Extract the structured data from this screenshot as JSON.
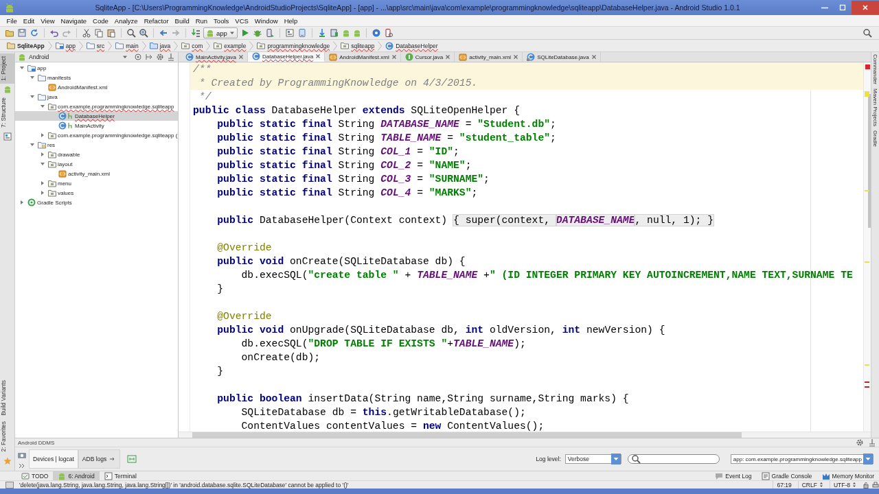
{
  "window": {
    "title": "SqliteApp - [C:\\Users\\ProgrammingKnowledge\\AndroidStudioProjects\\SqliteApp] - [app] - ...\\app\\src\\main\\java\\com\\example\\programmingknowledge\\sqliteapp\\DatabaseHelper.java - Android Studio 1.0.1"
  },
  "menu": [
    "File",
    "Edit",
    "View",
    "Navigate",
    "Code",
    "Analyze",
    "Refactor",
    "Build",
    "Run",
    "Tools",
    "VCS",
    "Window",
    "Help"
  ],
  "toolbar": {
    "run_config": "app"
  },
  "breadcrumbs": [
    {
      "label": "SqliteApp",
      "kind": "project",
      "error": false
    },
    {
      "label": "app",
      "kind": "module",
      "error": true
    },
    {
      "label": "src",
      "kind": "folder",
      "error": true
    },
    {
      "label": "main",
      "kind": "folder",
      "error": true
    },
    {
      "label": "java",
      "kind": "source",
      "error": true
    },
    {
      "label": "com",
      "kind": "package",
      "error": true
    },
    {
      "label": "example",
      "kind": "package",
      "error": true
    },
    {
      "label": "programmingknowledge",
      "kind": "package",
      "error": true
    },
    {
      "label": "sqliteapp",
      "kind": "package",
      "error": true
    },
    {
      "label": "DatabaseHelper",
      "kind": "class",
      "error": true
    }
  ],
  "side_tabs": {
    "left_top": [
      {
        "label": "1: Project",
        "selected": true
      },
      {
        "label": "7: Structure",
        "selected": false
      }
    ],
    "left_bottom": [
      {
        "label": "Build Variants",
        "selected": false
      },
      {
        "label": "2: Favorites",
        "selected": false
      }
    ],
    "right": [
      {
        "label": "Commander"
      },
      {
        "label": "Maven Projects"
      },
      {
        "label": "Gradle"
      }
    ]
  },
  "project": {
    "view": "Android",
    "tree": [
      {
        "label": "app",
        "kind": "module",
        "expanded": true,
        "selected": false,
        "error": false,
        "children": [
          {
            "label": "manifests",
            "kind": "folder",
            "expanded": true,
            "selected": false,
            "error": false,
            "children": [
              {
                "label": "AndroidManifest.xml",
                "kind": "xml",
                "selected": false,
                "error": false
              }
            ]
          },
          {
            "label": "java",
            "kind": "folder",
            "expanded": true,
            "selected": false,
            "error": false,
            "children": [
              {
                "label": "com.example.programmingknowledge.sqliteapp",
                "kind": "package",
                "expanded": true,
                "selected": false,
                "error": true,
                "children": [
                  {
                    "label": "DatabaseHelper",
                    "kind": "class",
                    "selected": true,
                    "error": true
                  },
                  {
                    "label": "MainActivity",
                    "kind": "class",
                    "selected": false,
                    "error": false
                  }
                ]
              },
              {
                "label": "com.example.programmingknowledge.sqliteapp (",
                "kind": "package",
                "expanded": false,
                "selected": false,
                "error": false
              }
            ]
          },
          {
            "label": "res",
            "kind": "resfolder",
            "expanded": true,
            "selected": false,
            "error": false,
            "children": [
              {
                "label": "drawable",
                "kind": "package",
                "expanded": false,
                "selected": false,
                "error": false
              },
              {
                "label": "layout",
                "kind": "package",
                "expanded": true,
                "selected": false,
                "error": false,
                "children": [
                  {
                    "label": "activity_main.xml",
                    "kind": "xml",
                    "selected": false,
                    "error": false
                  }
                ]
              },
              {
                "label": "menu",
                "kind": "package",
                "expanded": false,
                "selected": false,
                "error": false
              },
              {
                "label": "values",
                "kind": "package",
                "expanded": false,
                "selected": false,
                "error": false
              }
            ]
          }
        ]
      },
      {
        "label": "Gradle Scripts",
        "kind": "gradle",
        "expanded": false,
        "selected": false,
        "error": false
      }
    ]
  },
  "editor": {
    "tabs": [
      {
        "label": "MainActivity.java",
        "kind": "class",
        "selected": false,
        "error": true
      },
      {
        "label": "DatabaseHelper.java",
        "kind": "class",
        "selected": true,
        "error": true
      },
      {
        "label": "AndroidManifest.xml",
        "kind": "xml",
        "selected": false,
        "error": false
      },
      {
        "label": "Cursor.java",
        "kind": "interface",
        "selected": false,
        "error": false
      },
      {
        "label": "activity_main.xml",
        "kind": "xml",
        "selected": false,
        "error": false
      },
      {
        "label": "SQLiteDatabase.java",
        "kind": "library",
        "selected": false,
        "error": false
      }
    ],
    "lines": [
      {
        "highlighted": true,
        "segments": [
          {
            "kind": "comment",
            "text": "/**"
          }
        ]
      },
      {
        "highlighted": true,
        "segments": [
          {
            "kind": "comment",
            "text": " * Created by ProgrammingKnowledge on 4/3/2015."
          }
        ]
      },
      {
        "highlighted": false,
        "segments": [
          {
            "kind": "comment",
            "text": " */"
          }
        ]
      },
      {
        "highlighted": false,
        "segments": [
          {
            "kind": "keyword",
            "text": "public class"
          },
          {
            "kind": "plain",
            "text": " DatabaseHelper "
          },
          {
            "kind": "keyword",
            "text": "extends"
          },
          {
            "kind": "plain",
            "text": " SQLiteOpenHelper {"
          }
        ]
      },
      {
        "highlighted": false,
        "segments": [
          {
            "kind": "keyword",
            "text": "    public static final"
          },
          {
            "kind": "plain",
            "text": " String "
          },
          {
            "kind": "constant",
            "text": "DATABASE_NAME"
          },
          {
            "kind": "plain",
            "text": " = "
          },
          {
            "kind": "string",
            "text": "\"Student.db\""
          },
          {
            "kind": "plain",
            "text": ";"
          }
        ]
      },
      {
        "highlighted": false,
        "segments": [
          {
            "kind": "keyword",
            "text": "    public static final"
          },
          {
            "kind": "plain",
            "text": " String "
          },
          {
            "kind": "constant",
            "text": "TABLE_NAME"
          },
          {
            "kind": "plain",
            "text": " = "
          },
          {
            "kind": "string",
            "text": "\"student_table\""
          },
          {
            "kind": "plain",
            "text": ";"
          }
        ]
      },
      {
        "highlighted": false,
        "segments": [
          {
            "kind": "keyword",
            "text": "    public static final"
          },
          {
            "kind": "plain",
            "text": " String "
          },
          {
            "kind": "constant",
            "text": "COL_1"
          },
          {
            "kind": "plain",
            "text": " = "
          },
          {
            "kind": "string",
            "text": "\"ID\""
          },
          {
            "kind": "plain",
            "text": ";"
          }
        ]
      },
      {
        "highlighted": false,
        "segments": [
          {
            "kind": "keyword",
            "text": "    public static final"
          },
          {
            "kind": "plain",
            "text": " String "
          },
          {
            "kind": "constant",
            "text": "COL_2"
          },
          {
            "kind": "plain",
            "text": " = "
          },
          {
            "kind": "string",
            "text": "\"NAME\""
          },
          {
            "kind": "plain",
            "text": ";"
          }
        ]
      },
      {
        "highlighted": false,
        "segments": [
          {
            "kind": "keyword",
            "text": "    public static final"
          },
          {
            "kind": "plain",
            "text": " String "
          },
          {
            "kind": "constant",
            "text": "COL_3"
          },
          {
            "kind": "plain",
            "text": " = "
          },
          {
            "kind": "string",
            "text": "\"SURNAME\""
          },
          {
            "kind": "plain",
            "text": ";"
          }
        ]
      },
      {
        "highlighted": false,
        "segments": [
          {
            "kind": "keyword",
            "text": "    public static final"
          },
          {
            "kind": "plain",
            "text": " String "
          },
          {
            "kind": "constant",
            "text": "COL_4"
          },
          {
            "kind": "plain",
            "text": " = "
          },
          {
            "kind": "string",
            "text": "\"MARKS\""
          },
          {
            "kind": "plain",
            "text": ";"
          }
        ]
      },
      {
        "highlighted": false
      },
      {
        "highlighted": false,
        "segments": [
          {
            "kind": "keyword",
            "text": "    public"
          },
          {
            "kind": "plain",
            "text": " DatabaseHelper(Context context) "
          },
          {
            "kind": "folded",
            "text": "{ super(context, "
          },
          {
            "kind": "folded-constant",
            "text": "DATABASE_NAME"
          },
          {
            "kind": "folded",
            "text": ", null, 1); }"
          }
        ]
      },
      {
        "highlighted": false
      },
      {
        "highlighted": false,
        "segments": [
          {
            "kind": "annotation",
            "text": "    @Override"
          }
        ]
      },
      {
        "highlighted": false,
        "segments": [
          {
            "kind": "keyword",
            "text": "    public void"
          },
          {
            "kind": "plain",
            "text": " onCreate(SQLiteDatabase db) {"
          }
        ]
      },
      {
        "highlighted": false,
        "segments": [
          {
            "kind": "plain",
            "text": "        db.execSQL("
          },
          {
            "kind": "string",
            "text": "\"create table \""
          },
          {
            "kind": "plain",
            "text": " + "
          },
          {
            "kind": "constant",
            "text": "TABLE_NAME"
          },
          {
            "kind": "plain",
            "text": " +"
          },
          {
            "kind": "string",
            "text": "\" (ID INTEGER PRIMARY KEY AUTOINCREMENT,NAME TEXT,SURNAME TE"
          }
        ]
      },
      {
        "highlighted": false,
        "segments": [
          {
            "kind": "plain",
            "text": "    }"
          }
        ]
      },
      {
        "highlighted": false
      },
      {
        "highlighted": false,
        "segments": [
          {
            "kind": "annotation",
            "text": "    @Override"
          }
        ]
      },
      {
        "highlighted": false,
        "segments": [
          {
            "kind": "keyword",
            "text": "    public void"
          },
          {
            "kind": "plain",
            "text": " onUpgrade(SQLiteDatabase db, "
          },
          {
            "kind": "keyword",
            "text": "int"
          },
          {
            "kind": "plain",
            "text": " oldVersion, "
          },
          {
            "kind": "keyword",
            "text": "int"
          },
          {
            "kind": "plain",
            "text": " newVersion) {"
          }
        ]
      },
      {
        "highlighted": false,
        "segments": [
          {
            "kind": "plain",
            "text": "        db.execSQL("
          },
          {
            "kind": "string",
            "text": "\"DROP TABLE IF EXISTS \""
          },
          {
            "kind": "plain",
            "text": "+"
          },
          {
            "kind": "constant",
            "text": "TABLE_NAME"
          },
          {
            "kind": "plain",
            "text": ");"
          }
        ]
      },
      {
        "highlighted": false,
        "segments": [
          {
            "kind": "plain",
            "text": "        onCreate(db);"
          }
        ]
      },
      {
        "highlighted": false,
        "segments": [
          {
            "kind": "plain",
            "text": "    }"
          }
        ]
      },
      {
        "highlighted": false
      },
      {
        "highlighted": false,
        "segments": [
          {
            "kind": "keyword",
            "text": "    public boolean"
          },
          {
            "kind": "plain",
            "text": " insertData(String name,String surname,String marks) {"
          }
        ]
      },
      {
        "highlighted": false,
        "segments": [
          {
            "kind": "plain",
            "text": "        SQLiteDatabase db = "
          },
          {
            "kind": "keyword",
            "text": "this"
          },
          {
            "kind": "plain",
            "text": ".getWritableDatabase();"
          }
        ]
      },
      {
        "highlighted": false,
        "segments": [
          {
            "kind": "plain",
            "text": "        ContentValues contentValues = "
          },
          {
            "kind": "keyword",
            "text": "new"
          },
          {
            "kind": "plain",
            "text": " ContentValues();"
          }
        ]
      }
    ]
  },
  "ddms": {
    "title": "Android DDMS",
    "tabs": [
      {
        "label": "Devices | logcat",
        "selected": true
      },
      {
        "label": "ADB logs",
        "selected": false
      }
    ],
    "log_level_label": "Log level:",
    "log_level": "Verbose",
    "app_filter": "app: com.example.programmingknowledge.sqliteapp"
  },
  "tool_windows": {
    "left": [
      {
        "label": "TODO",
        "selected": false
      },
      {
        "label": "6: Android",
        "selected": true
      },
      {
        "label": "Terminal",
        "selected": false
      }
    ],
    "right": [
      {
        "label": "Event Log"
      },
      {
        "label": "Gradle Console"
      },
      {
        "label": "Memory Monitor"
      }
    ]
  },
  "status_bar": {
    "message": "'delete(java.lang.String, java.lang.String, java.lang.String[])' in 'android.database.sqlite.SQLiteDatabase' cannot be applied to '()'",
    "position": "67:19",
    "line_separator": "CRLF",
    "encoding": "UTF-8"
  }
}
